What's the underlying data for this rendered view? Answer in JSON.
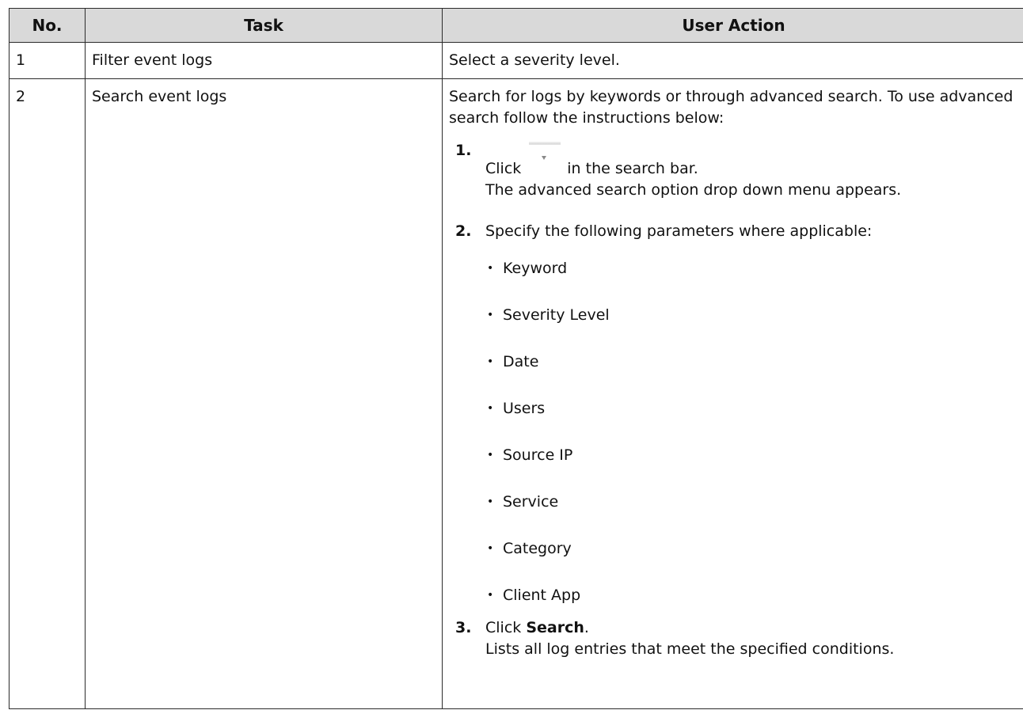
{
  "table": {
    "headers": {
      "no": "No.",
      "task": "Task",
      "user_action": "User Action"
    },
    "rows": [
      {
        "no": "1",
        "task": "Filter event logs",
        "action": "Select a severity level."
      },
      {
        "no": "2",
        "task": "Search event logs",
        "action_intro": "Search for logs by keywords or through advanced search. To use advanced search follow the instructions below:",
        "steps": [
          {
            "number": "1.",
            "before_icon": "Click",
            "icon": "advanced-search-dropdown-icon",
            "after_icon": "in the search bar.",
            "result": "The advanced search option drop down menu appears."
          },
          {
            "number": "2.",
            "text": "Specify the following parameters where applicable:",
            "params": [
              "Keyword",
              "Severity Level",
              "Date",
              "Users",
              "Source IP",
              "Service",
              "Category",
              "Client App"
            ]
          },
          {
            "number": "3.",
            "before_bold": "Click",
            "bold": "Search",
            "after_bold": ".",
            "result": "Lists all log entries that meet the specified conditions."
          }
        ]
      }
    ]
  },
  "colors": {
    "header_background": "#d9d9d9",
    "border": "#2b2b2b",
    "text": "#111111"
  }
}
